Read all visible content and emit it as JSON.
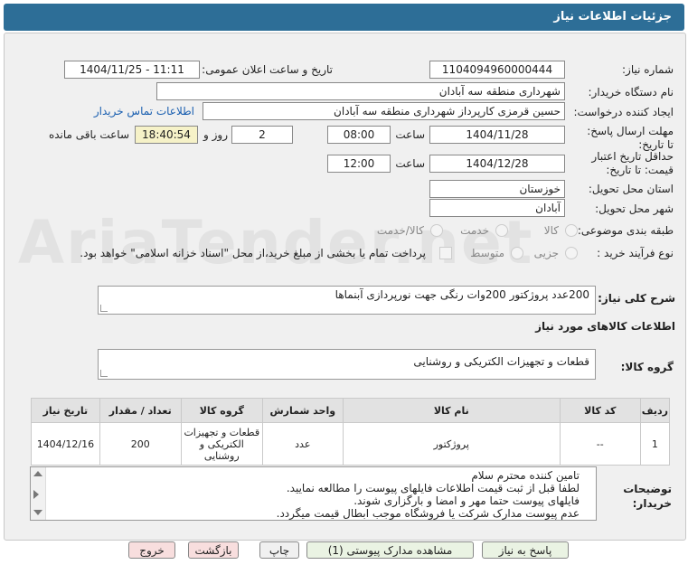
{
  "header": {
    "title": "جزئیات اطلاعات نیاز"
  },
  "fields": {
    "need_number_label": "شماره نیاز:",
    "need_number": "1104094960000444",
    "announce_label": "تاریخ و ساعت اعلان عمومی:",
    "announce_value": "1404/11/25 - 11:11",
    "buyer_org_label": "نام دستگاه خریدار:",
    "buyer_org": "شهرداری منطقه سه آبادان",
    "creator_label": "ایجاد کننده درخواست:",
    "creator": "حسین قرمزی کارپرداز شهرداری منطقه سه آبادان",
    "contact_link": "اطلاعات تماس خریدار",
    "deadline_label": "مهلت ارسال پاسخ: تا تاریخ:",
    "deadline_date": "1404/11/28",
    "time_label": "ساعت",
    "deadline_time": "08:00",
    "days_value": "2",
    "days_label": "روز و",
    "remaining_time": "18:40:54",
    "remaining_label": "ساعت باقی مانده",
    "validity_label": "حداقل تاریخ اعتبار قیمت: تا تاریخ:",
    "validity_date": "1404/12/28",
    "validity_time": "12:00",
    "province_label": "استان محل تحویل:",
    "province": "خوزستان",
    "city_label": "شهر محل تحویل:",
    "city": "آبادان",
    "category_label": "طبقه بندی موضوعی:",
    "category_options": [
      "کالا",
      "خدمت",
      "کالا/خدمت"
    ],
    "process_label": "نوع فرآیند خرید :",
    "process_options": [
      "جزیی",
      "متوسط"
    ],
    "payment_note": "پرداخت تمام یا بخشی از مبلغ خرید،از محل \"اسناد خزانه اسلامی\" خواهد بود."
  },
  "description": {
    "label": "شرح کلی نیاز:",
    "text": "200عدد پروژکتور 200وات رنگی جهت نورپردازی آبنماها"
  },
  "goods_section": {
    "title": "اطلاعات کالاهای مورد نیاز"
  },
  "goods_group": {
    "label": "گروه کالا:",
    "value": "قطعات و تجهیزات الکتریکی و روشنایی"
  },
  "table": {
    "headers": [
      "ردیف",
      "کد کالا",
      "نام کالا",
      "واحد شمارش",
      "گروه کالا",
      "تعداد / مقدار",
      "تاریخ نیاز"
    ],
    "rows": [
      [
        "1",
        "--",
        "پروژکتور",
        "عدد",
        "قطعات و تجهیزات الکتریکی و روشنایی",
        "200",
        "1404/12/16"
      ]
    ]
  },
  "buyer_notes": {
    "label": "توضیحات خریدار:",
    "lines": [
      "تامین کننده محترم سلام",
      "لطفا قبل از ثبت قیمت اطلاعات فایلهای پیوست را مطالعه نمایید.",
      "فایلهای پیوست حتما مهر و امضا و بارگزاری شوند.",
      "عدم پیوست مدارک شرکت یا فروشگاه موجب ابطال قیمت میگردد."
    ]
  },
  "buttons": {
    "reply": "پاسخ به نیاز",
    "attachments": "مشاهده مدارک پیوستی (1)",
    "print": "چاپ",
    "back": "بازگشت",
    "exit": "خروج"
  }
}
